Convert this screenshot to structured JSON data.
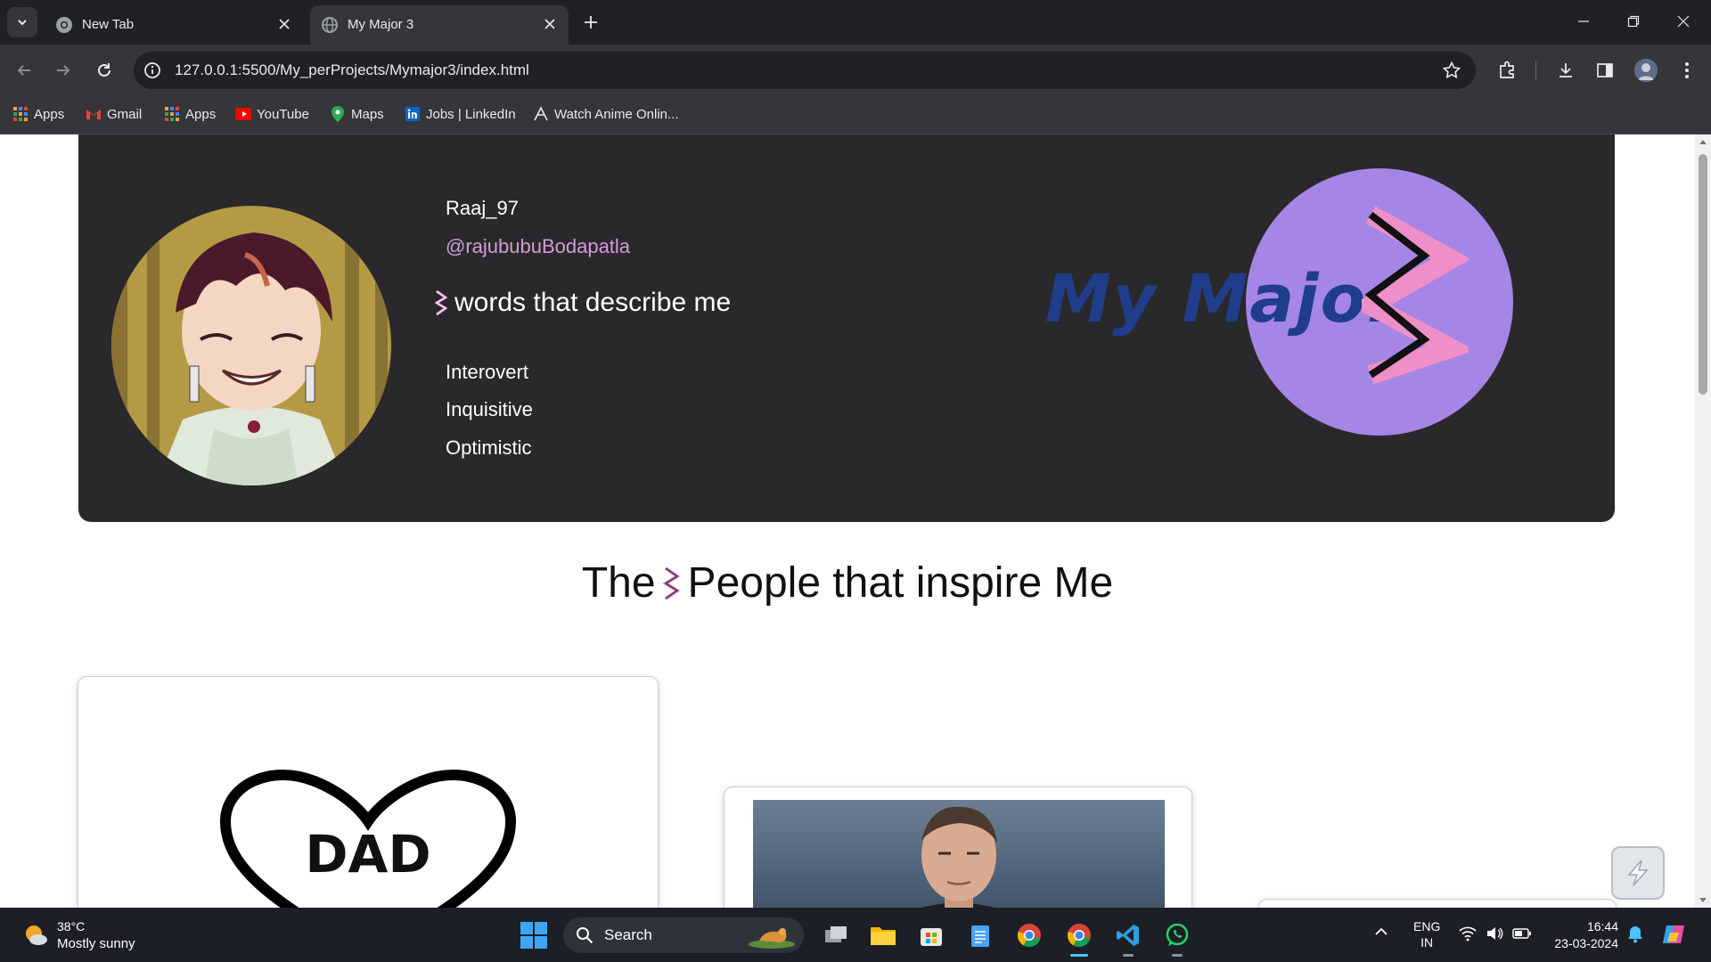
{
  "browser": {
    "tabs": [
      {
        "title": "New Tab"
      },
      {
        "title": "My Major 3"
      }
    ],
    "url": "127.0.0.1:5500/My_perProjects/Mymajor3/index.html",
    "bookmarks": [
      "Apps",
      "Gmail",
      "Apps",
      "YouTube",
      "Maps",
      "Jobs | LinkedIn",
      "Watch Anime Onlin..."
    ]
  },
  "page": {
    "profile": {
      "username": "Raaj_97",
      "handle": "@rajububuBodapatla",
      "words_heading": "words that describe me",
      "traits": [
        "Interovert",
        "Inquisitive",
        "Optimistic"
      ]
    },
    "brand": {
      "text": "My Major"
    },
    "inspire_heading": {
      "before": "The",
      "after": "People that inspire Me"
    },
    "cards": {
      "dad_label": "DAD"
    }
  },
  "taskbar": {
    "weather": {
      "temp": "38°C",
      "condition": "Mostly sunny"
    },
    "search_label": "Search",
    "language": {
      "line1": "ENG",
      "line2": "IN"
    },
    "time": "16:44",
    "date": "23-03-2024"
  },
  "colors": {
    "hero_bg": "#29292b",
    "accent_pink": "#e48bd0",
    "brand_circle": "#a585e6",
    "brand_text": "#1f3d8a"
  }
}
